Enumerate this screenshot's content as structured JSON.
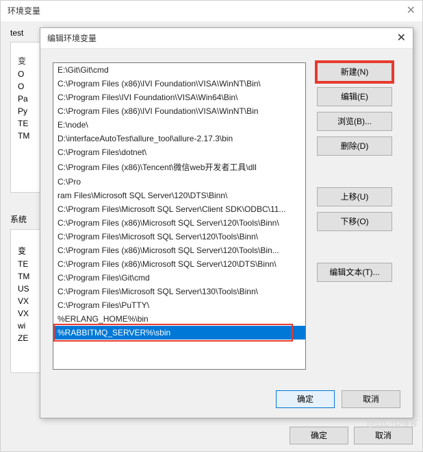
{
  "outer": {
    "title": "环境变量",
    "user_group_label": "test",
    "sys_group_label": "系统",
    "col_var": "变",
    "user_rows": [
      "O",
      "O",
      "Pa",
      "Py",
      "TE",
      "TM"
    ],
    "sys_rows": [
      "变",
      "TE",
      "TM",
      "US",
      "VX",
      "VX",
      "wi",
      "ZE"
    ],
    "ok": "确定",
    "cancel": "取消"
  },
  "inner": {
    "title": "编辑环境变量",
    "items": [
      "E:\\Git\\Git\\cmd",
      "C:\\Program Files (x86)\\IVI Foundation\\VISA\\WinNT\\Bin\\",
      "C:\\Program Files\\IVI Foundation\\VISA\\Win64\\Bin\\",
      "C:\\Program Files (x86)\\IVI Foundation\\VISA\\WinNT\\Bin",
      "E:\\node\\",
      "D:\\interfaceAutoTest\\allure_tool\\allure-2.17.3\\bin",
      "C:\\Program Files\\dotnet\\",
      "C:\\Program Files (x86)\\Tencent\\微信web开发者工具\\dll",
      "C:\\Pro",
      "ram Files\\Microsoft SQL Server\\120\\DTS\\Binn\\",
      "C:\\Program Files\\Microsoft SQL Server\\Client SDK\\ODBC\\11...",
      "C:\\Program Files (x86)\\Microsoft SQL Server\\120\\Tools\\Binn\\",
      "C:\\Program Files\\Microsoft SQL Server\\120\\Tools\\Binn\\",
      "C:\\Program Files (x86)\\Microsoft SQL Server\\120\\Tools\\Bin...",
      "C:\\Program Files (x86)\\Microsoft SQL Server\\120\\DTS\\Binn\\",
      "C:\\Program Files\\Git\\cmd",
      "C:\\Program Files\\Microsoft SQL Server\\130\\Tools\\Binn\\",
      "C:\\Program Files\\PuTTY\\",
      "%ERLANG_HOME%\\bin"
    ],
    "editing_value": "%RABBITMQ_SERVER%\\sbin",
    "buttons": {
      "new": "新建(N)",
      "edit": "编辑(E)",
      "browse": "浏览(B)...",
      "delete": "删除(D)",
      "up": "上移(U)",
      "down": "下移(O)",
      "edit_text": "编辑文本(T)..."
    },
    "ok": "确定",
    "cancel": "取消"
  },
  "watermark": "@51CTO博客"
}
